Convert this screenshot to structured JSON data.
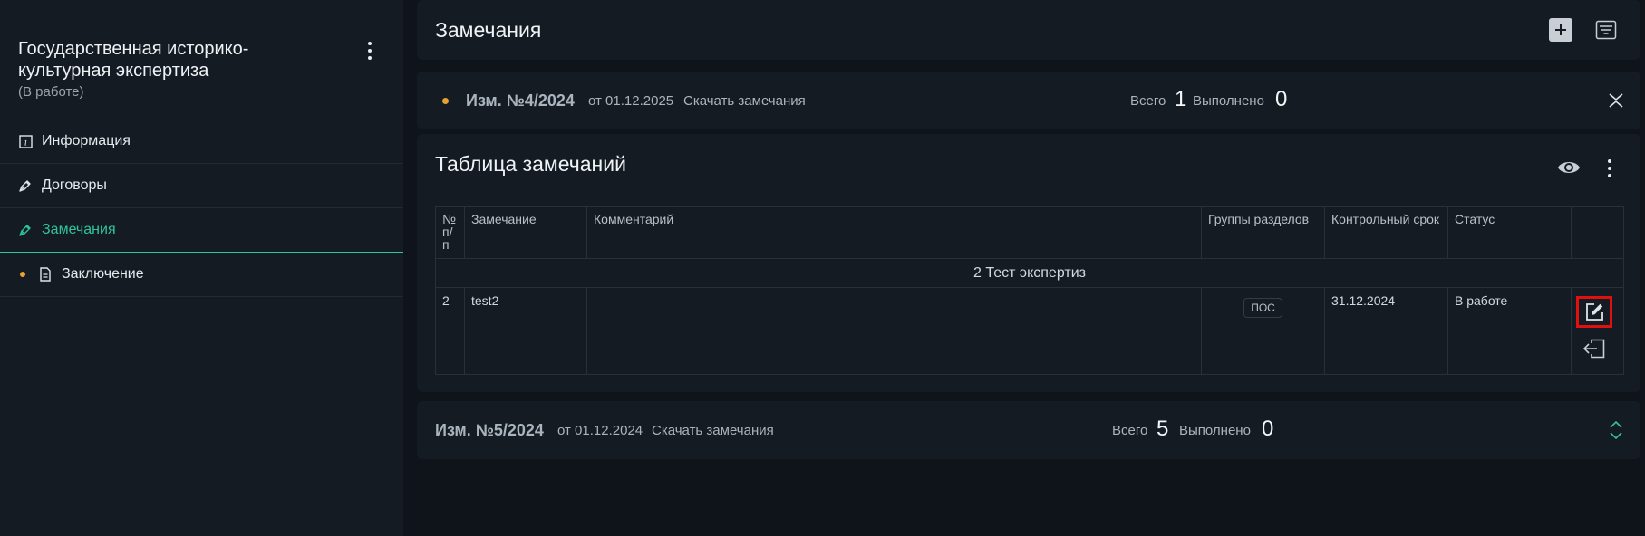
{
  "sidebar": {
    "project_title": "Государственная историко-культурная экспертиза",
    "project_status": "(В работе)",
    "items": [
      {
        "label": "Информация",
        "icon": "info-icon"
      },
      {
        "label": "Договоры",
        "icon": "pen-icon"
      },
      {
        "label": "Замечания",
        "icon": "pen-icon",
        "active": true
      },
      {
        "label": "Заключение",
        "icon": "document-icon",
        "badge": "orange-dot"
      }
    ]
  },
  "header": {
    "title": "Замечания"
  },
  "revisions": [
    {
      "number": "Изм. №4/2024",
      "date_text": "от 01.12.2025",
      "download_label": "Скачать замечания",
      "total_label": "Всего",
      "total_value": "1",
      "done_label": "Выполнено",
      "done_value": "0",
      "expanded": true
    },
    {
      "number": "Изм. №5/2024",
      "date_text": "от 01.12.2024",
      "download_label": "Скачать замечания",
      "total_label": "Всего",
      "total_value": "5",
      "done_label": "Выполнено",
      "done_value": "0",
      "expanded": false
    }
  ],
  "table": {
    "title": "Таблица замечаний",
    "columns": [
      "№ п/п",
      "Замечание",
      "Комментарий",
      "Группы разделов",
      "Контрольный срок",
      "Статус",
      ""
    ],
    "group_label": "2 Тест экспертиз",
    "rows": [
      {
        "num": "2",
        "remark": "test2",
        "comment": "",
        "section_group": "ПОС",
        "deadline": "31.12.2024",
        "status": "В работе"
      }
    ]
  },
  "colors": {
    "accent": "#2fc4a0",
    "warning_dot": "#e8a033",
    "highlight": "#e01010",
    "panel": "#141b22",
    "background": "#0e141a"
  }
}
